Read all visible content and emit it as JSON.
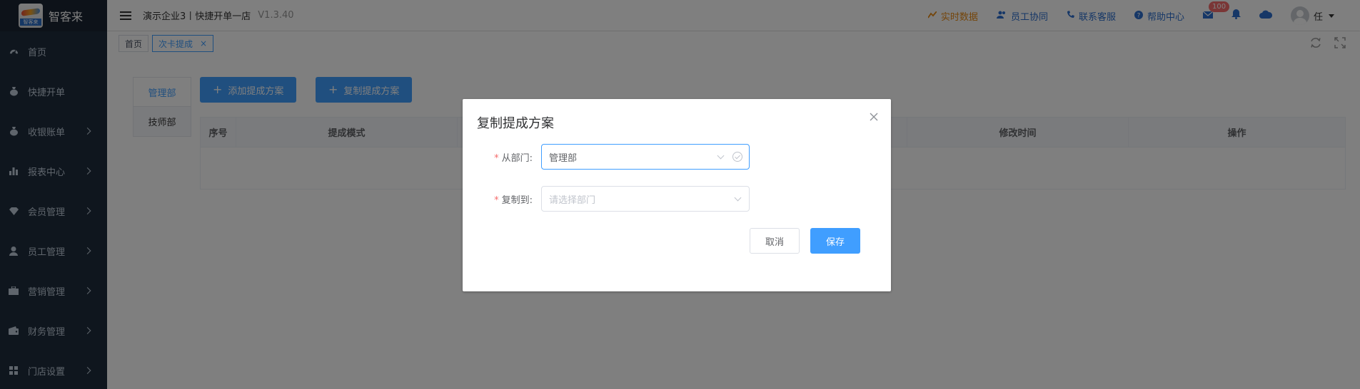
{
  "brand": {
    "name": "智客来",
    "logo_text": "智客来"
  },
  "sidebar": {
    "items": [
      {
        "label": "首页",
        "icon": "dashboard-icon",
        "has_arrow": false
      },
      {
        "label": "快捷开单",
        "icon": "moneybag-icon",
        "has_arrow": false
      },
      {
        "label": "收银账单",
        "icon": "moneybag-icon",
        "has_arrow": true
      },
      {
        "label": "报表中心",
        "icon": "bar-chart-icon",
        "has_arrow": true
      },
      {
        "label": "会员管理",
        "icon": "diamond-icon",
        "has_arrow": true
      },
      {
        "label": "员工管理",
        "icon": "user-icon",
        "has_arrow": true
      },
      {
        "label": "营销管理",
        "icon": "briefcase-icon",
        "has_arrow": true
      },
      {
        "label": "财务管理",
        "icon": "wallet-icon",
        "has_arrow": true
      },
      {
        "label": "门店设置",
        "icon": "grid-icon",
        "has_arrow": true
      }
    ]
  },
  "header": {
    "title": "演示企业3丨快捷开单一店",
    "version": "V1.3.40",
    "links": {
      "realtime": "实时数据",
      "staff": "员工协同",
      "support": "联系客服",
      "help": "帮助中心"
    },
    "mail_badge": "100",
    "user_name": "任"
  },
  "tags": {
    "home": "首页",
    "current": "次卡提成",
    "close_symbol": "×"
  },
  "main": {
    "dept_tabs": [
      "管理部",
      "技师部"
    ],
    "add_button": "添加提成方案",
    "copy_button": "复制提成方案",
    "columns": [
      "序号",
      "提成模式",
      "",
      "",
      "修改时间",
      "操作"
    ]
  },
  "dialog": {
    "title": "复制提成方案",
    "from_label": "从部门:",
    "from_value": "管理部",
    "to_label": "复制到:",
    "to_placeholder": "请选择部门",
    "cancel": "取消",
    "save": "保存"
  },
  "colors": {
    "primary": "#409eff",
    "sidebar": "#1f2d3d",
    "orange": "#e98b14",
    "danger": "#f56c6c"
  }
}
